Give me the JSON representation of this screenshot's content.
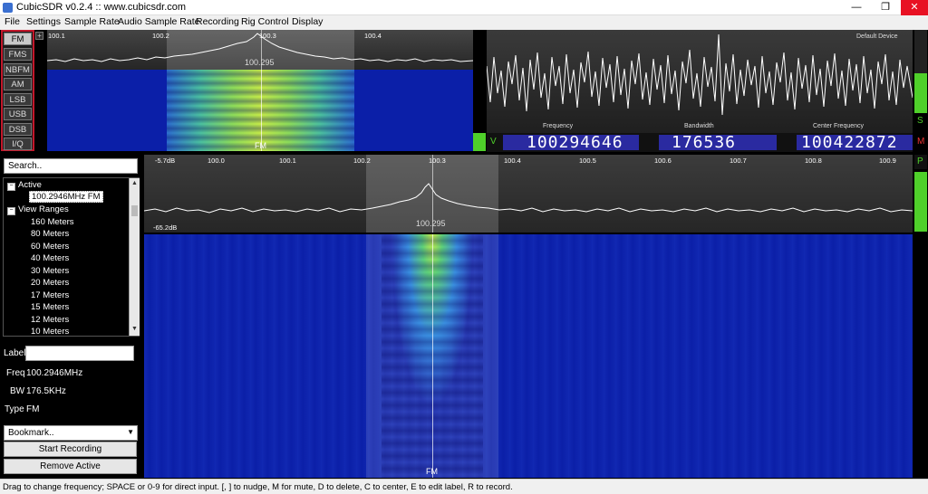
{
  "window": {
    "title": "CubicSDR v0.2.4 :: www.cubicsdr.com",
    "minimize": "—",
    "maximize": "❐",
    "close": "✕"
  },
  "menu": [
    "File",
    "Settings",
    "Sample Rate",
    "Audio Sample Rate",
    "Recording",
    "Rig Control",
    "Display"
  ],
  "modes": {
    "items": [
      "FM",
      "FMS",
      "NBFM",
      "AM",
      "LSB",
      "USB",
      "DSB",
      "I/Q"
    ],
    "active": "FM"
  },
  "demod_spectrum": {
    "ticks": [
      "100.1",
      "100.2",
      "100.3",
      "100.4"
    ],
    "center_label": "100.295",
    "waterfall_label": "FM"
  },
  "scope": {
    "device": "Default Device",
    "frequency_label": "Frequency",
    "bandwidth_label": "Bandwidth",
    "center_label": "Center Frequency",
    "frequency": "100294646",
    "bandwidth": "176536",
    "center": "100422872",
    "v_label": "V",
    "s_label": "S",
    "m_label": "M",
    "p_label": "P"
  },
  "main_spectrum": {
    "top_db": "-5.7dB",
    "bottom_db": "-65.2dB",
    "ticks": [
      "100.0",
      "100.1",
      "100.2",
      "100.3",
      "100.4",
      "100.5",
      "100.6",
      "100.7",
      "100.8",
      "100.9"
    ],
    "center_label": "100.295",
    "waterfall_label": "FM"
  },
  "bookmarks": {
    "search_placeholder": "Search..",
    "active_group": "Active",
    "active_item": "100.2946MHz FM",
    "ranges_group": "View Ranges",
    "ranges": [
      "160 Meters",
      "80 Meters",
      "60 Meters",
      "40 Meters",
      "30 Meters",
      "20 Meters",
      "17 Meters",
      "15 Meters",
      "12 Meters",
      "10 Meters"
    ],
    "label_caption": "Label",
    "label_value": "",
    "freq_caption": "Freq",
    "freq_value": "100.2946MHz",
    "bw_caption": "BW",
    "bw_value": "176.5KHz",
    "type_caption": "Type",
    "type_value": "FM",
    "bookmark_select": "Bookmark..",
    "start_recording": "Start Recording",
    "remove_active": "Remove Active"
  },
  "status": "Drag to change frequency; SPACE or 0-9 for direct input. [, ] to nudge, M for mute, D to delete, C to center, E to edit label, R to record.",
  "colors": {
    "accent_red": "#c2182b",
    "waterfall_blue": "#0b1fa8",
    "signal_green": "#4fd02a"
  }
}
